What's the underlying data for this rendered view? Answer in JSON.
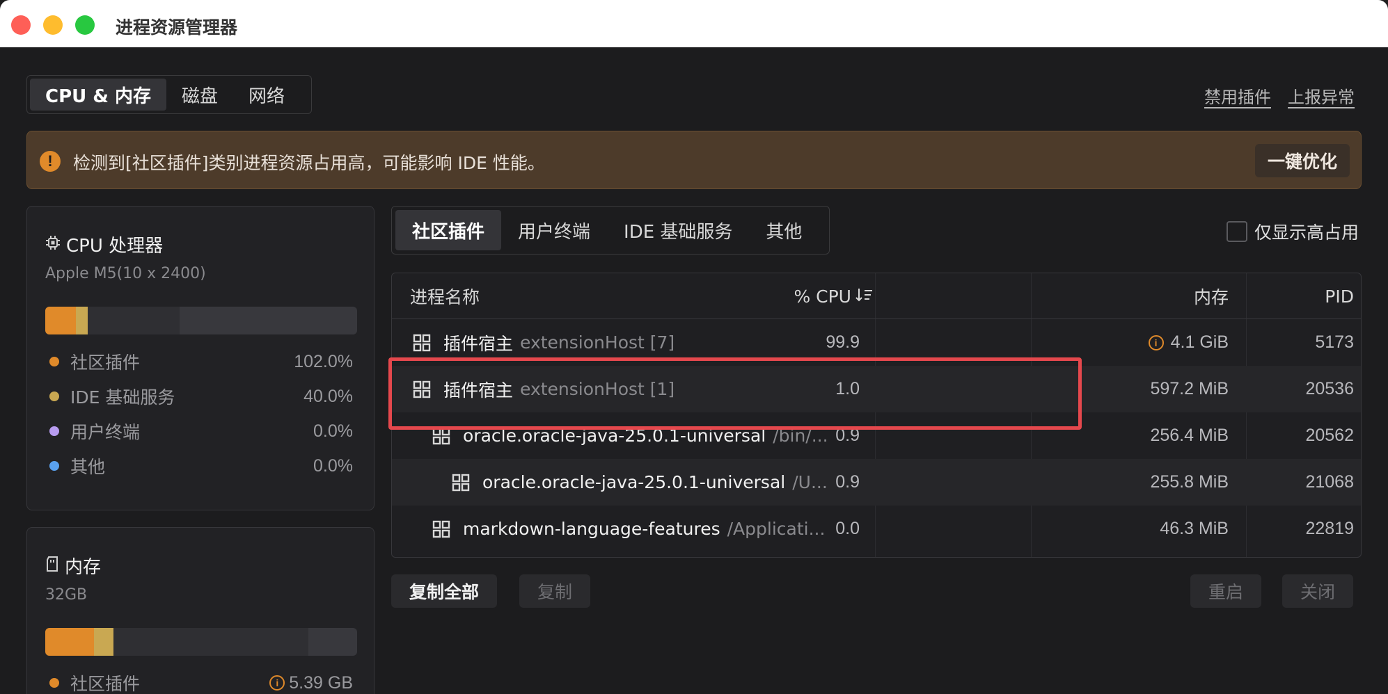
{
  "window": {
    "title": "进程资源管理器"
  },
  "top_tabs": [
    {
      "label": "CPU & 内存",
      "active": true
    },
    {
      "label": "磁盘",
      "active": false
    },
    {
      "label": "网络",
      "active": false
    }
  ],
  "top_links": {
    "disable_plugins": "禁用插件",
    "report_issue": "上报异常"
  },
  "banner": {
    "text": "检测到[社区插件]类别进程资源占用高，可能影响 IDE 性能。",
    "button": "一键优化"
  },
  "cpu_card": {
    "title": "CPU 处理器",
    "subtitle": "Apple M5(10 x 2400)",
    "bar": [
      {
        "fraction": 0.099,
        "color": "#e08a2a"
      },
      {
        "fraction": 0.039,
        "color": "#c9a852"
      }
    ],
    "legend": [
      {
        "name": "社区插件",
        "value": "102.0%",
        "color": "#e08a2a"
      },
      {
        "name": "IDE 基础服务",
        "value": "40.0%",
        "color": "#c9a852"
      },
      {
        "name": "用户终端",
        "value": "0.0%",
        "color": "#b89cf0"
      },
      {
        "name": "其他",
        "value": "0.0%",
        "color": "#5aa2f0"
      }
    ]
  },
  "mem_card": {
    "title": "内存",
    "subtitle": "32GB",
    "bar": [
      {
        "fraction": 0.157,
        "color": "#e08a2a"
      },
      {
        "fraction": 0.062,
        "color": "#c9a852"
      }
    ],
    "legend": [
      {
        "name": "社区插件",
        "value": "5.39 GB",
        "color": "#e08a2a",
        "warn": true
      }
    ]
  },
  "category_tabs": [
    {
      "label": "社区插件",
      "active": true
    },
    {
      "label": "用户终端",
      "active": false
    },
    {
      "label": "IDE 基础服务",
      "active": false
    },
    {
      "label": "其他",
      "active": false
    }
  ],
  "filter": {
    "label": "仅显示高占用",
    "checked": false
  },
  "table": {
    "headers": {
      "name": "进程名称",
      "cpu": "% CPU",
      "memory": "内存",
      "pid": "PID"
    },
    "rows": [
      {
        "indent": 0,
        "name": "插件宿主",
        "sub": "extensionHost [7]",
        "cpu": "99.9",
        "memory": "4.1 GiB",
        "mem_warn": true,
        "pid": "5173"
      },
      {
        "indent": 0,
        "name": "插件宿主",
        "sub": "extensionHost [1]",
        "cpu": "1.0",
        "memory": "597.2 MiB",
        "mem_warn": false,
        "pid": "20536"
      },
      {
        "indent": 1,
        "name": "oracle.oracle-java-25.0.1-universal",
        "sub": "/bin/...",
        "cpu": "0.9",
        "memory": "256.4 MiB",
        "mem_warn": false,
        "pid": "20562"
      },
      {
        "indent": 2,
        "name": "oracle.oracle-java-25.0.1-universal",
        "sub": "/U...",
        "cpu": "0.9",
        "memory": "255.8 MiB",
        "mem_warn": false,
        "pid": "21068"
      },
      {
        "indent": 1,
        "name": "markdown-language-features",
        "sub": "/Applicati...",
        "cpu": "0.0",
        "memory": "46.3 MiB",
        "mem_warn": false,
        "pid": "22819"
      }
    ]
  },
  "actions": {
    "copy_all": "复制全部",
    "copy": "复制",
    "restart": "重启",
    "close": "关闭"
  },
  "accent": {
    "warning": "#e08a2a",
    "highlight": "#e5484d"
  }
}
